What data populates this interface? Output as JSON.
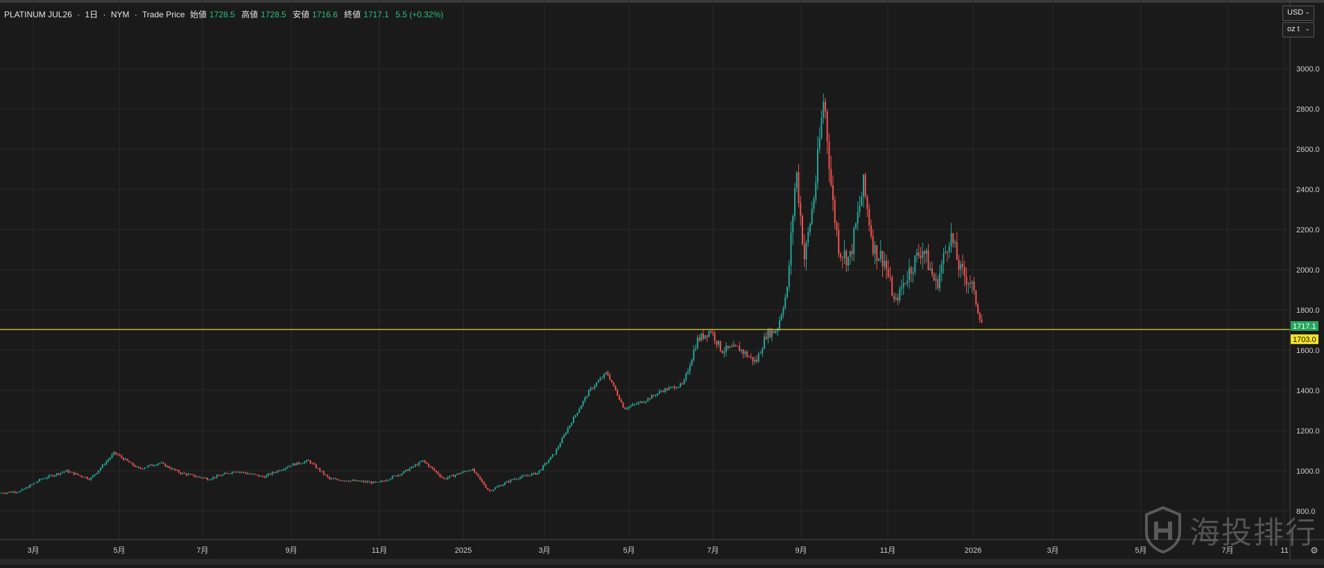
{
  "header": {
    "symbol": "PLATINUM JUL26",
    "interval": "1日",
    "exchange": "NYM",
    "price_type": "Trade Price",
    "open_label": "始値",
    "open": "1728.5",
    "high_label": "高値",
    "high": "1728.5",
    "low_label": "安値",
    "low": "1716.6",
    "close_label": "終値",
    "close": "1717.1",
    "change": "5.5 (+0.32%)"
  },
  "axis_controls": {
    "currency": "USD",
    "unit": "oz t"
  },
  "price_tags": {
    "last": "1717.1",
    "line": "1703.0"
  },
  "watermark": "海投排行",
  "colors": {
    "up": "#26a69a",
    "down": "#ef5350",
    "background": "#1a1a1a",
    "grid": "#2a2a2a",
    "hline": "#e6d23a",
    "last_tag": "#26a65b",
    "line_tag": "#f2e12a"
  },
  "chart_data": {
    "type": "candlestick",
    "ylim": [
      760,
      3200
    ],
    "y_ticks": [
      800,
      1000,
      1200,
      1400,
      1600,
      1800,
      2000,
      2200,
      2400,
      2600,
      2800,
      3000
    ],
    "y_tick_labels": [
      "800.0",
      "1000.0",
      "1200.0",
      "1400.0",
      "1600.0",
      "1800.0",
      "2000.0",
      "2200.0",
      "2400.0",
      "2600.0",
      "2800.0",
      "3000.0"
    ],
    "x_tick_labels": [
      "3月",
      "5月",
      "7月",
      "9月",
      "11月",
      "2025",
      "3月",
      "5月",
      "7月",
      "9月",
      "11月",
      "2026",
      "3月",
      "5月",
      "7月",
      "11"
    ],
    "horizontal_line": 1703.0,
    "last_price": 1717.1,
    "trend_points": [
      [
        0,
        890
      ],
      [
        30,
        900
      ],
      [
        60,
        960
      ],
      [
        95,
        1000
      ],
      [
        130,
        960
      ],
      [
        165,
        1090
      ],
      [
        200,
        1010
      ],
      [
        230,
        1040
      ],
      [
        260,
        990
      ],
      [
        300,
        960
      ],
      [
        340,
        1000
      ],
      [
        380,
        970
      ],
      [
        420,
        1030
      ],
      [
        445,
        1050
      ],
      [
        475,
        960
      ],
      [
        510,
        950
      ],
      [
        545,
        940
      ],
      [
        580,
        990
      ],
      [
        610,
        1050
      ],
      [
        640,
        960
      ],
      [
        680,
        1010
      ],
      [
        705,
        900
      ],
      [
        740,
        960
      ],
      [
        775,
        990
      ],
      [
        800,
        1090
      ],
      [
        820,
        1220
      ],
      [
        850,
        1400
      ],
      [
        875,
        1490
      ],
      [
        900,
        1310
      ],
      [
        930,
        1350
      ],
      [
        955,
        1400
      ],
      [
        985,
        1430
      ],
      [
        1005,
        1650
      ],
      [
        1025,
        1700
      ],
      [
        1040,
        1600
      ],
      [
        1065,
        1610
      ],
      [
        1090,
        1540
      ],
      [
        1105,
        1680
      ],
      [
        1120,
        1700
      ],
      [
        1135,
        1900
      ],
      [
        1148,
        2500
      ],
      [
        1160,
        2050
      ],
      [
        1175,
        2400
      ],
      [
        1188,
        2870
      ],
      [
        1200,
        2350
      ],
      [
        1210,
        2100
      ],
      [
        1225,
        2050
      ],
      [
        1245,
        2420
      ],
      [
        1260,
        2100
      ],
      [
        1275,
        2050
      ],
      [
        1290,
        1830
      ],
      [
        1310,
        1990
      ],
      [
        1330,
        2110
      ],
      [
        1350,
        1920
      ],
      [
        1370,
        2180
      ],
      [
        1385,
        1990
      ],
      [
        1400,
        1940
      ],
      [
        1410,
        1800
      ],
      [
        1418,
        1717
      ]
    ]
  }
}
